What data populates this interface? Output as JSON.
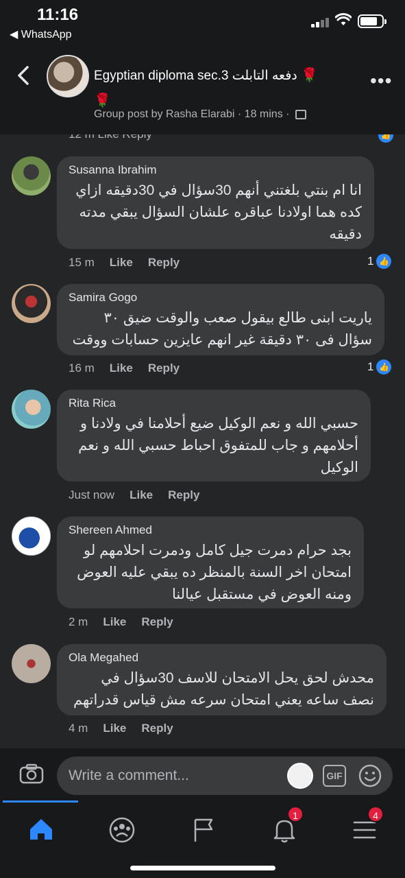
{
  "status_bar": {
    "time": "11:16",
    "back_app": "◀ WhatsApp"
  },
  "header": {
    "title": "Egyptian diploma sec.3 دفعه التابلت",
    "subtitle": "Group post by Rasha Elarabi · 18 mins ·",
    "more": "•••"
  },
  "previous_comment_meta": "12 m    Like    Reply",
  "comments": [
    {
      "name": "Susanna Ibrahim",
      "text": "انا ام بنتي بلغتني أنهم 30سؤال في 30دقيقه ازاي كده هما اولادنا عباقره علشان السؤال يبقي مدته دقيقه",
      "time": "15 m",
      "like": "Like",
      "reply": "Reply",
      "like_count": "1"
    },
    {
      "name": "Samira Gogo",
      "text": "ياريت ابنى طالع بيقول صعب والوقت ضيق ٣٠ سؤال فى ٣٠ دقيقة غير انهم عايزين حسابات ووقت",
      "time": "16 m",
      "like": "Like",
      "reply": "Reply",
      "like_count": "1"
    },
    {
      "name": "Rita Rica",
      "text": "حسبي الله و نعم الوكيل ضيع أحلامنا في ولادنا و أحلامهم و جاب للمتفوق احباط حسبي الله و نعم الوكيل",
      "time": "Just now",
      "like": "Like",
      "reply": "Reply",
      "like_count": ""
    },
    {
      "name": "Shereen Ahmed",
      "text": "بجد حرام دمرت جيل كامل ودمرت احلامهم لو امتحان اخر السنة بالمنظر ده يبقي عليه العوض ومنه العوض في مستقبل عيالنا",
      "time": "2 m",
      "like": "Like",
      "reply": "Reply",
      "like_count": ""
    },
    {
      "name": "Ola Megahed",
      "text": "محدش لحق يحل الامتحان للاسف 30سؤال في نصف ساعه  يعني امتحان سرعه مش قياس قدراتهم",
      "time": "4 m",
      "like": "Like",
      "reply": "Reply",
      "like_count": ""
    }
  ],
  "composer": {
    "placeholder": "Write a comment...",
    "gif_label": "GIF"
  },
  "tabbar": {
    "notifications_badge": "1",
    "menu_badge": "4"
  },
  "colors": {
    "accent": "#2d88ff",
    "badge": "#e41e3f",
    "bubble": "#3a3b3c",
    "background": "#242526"
  }
}
